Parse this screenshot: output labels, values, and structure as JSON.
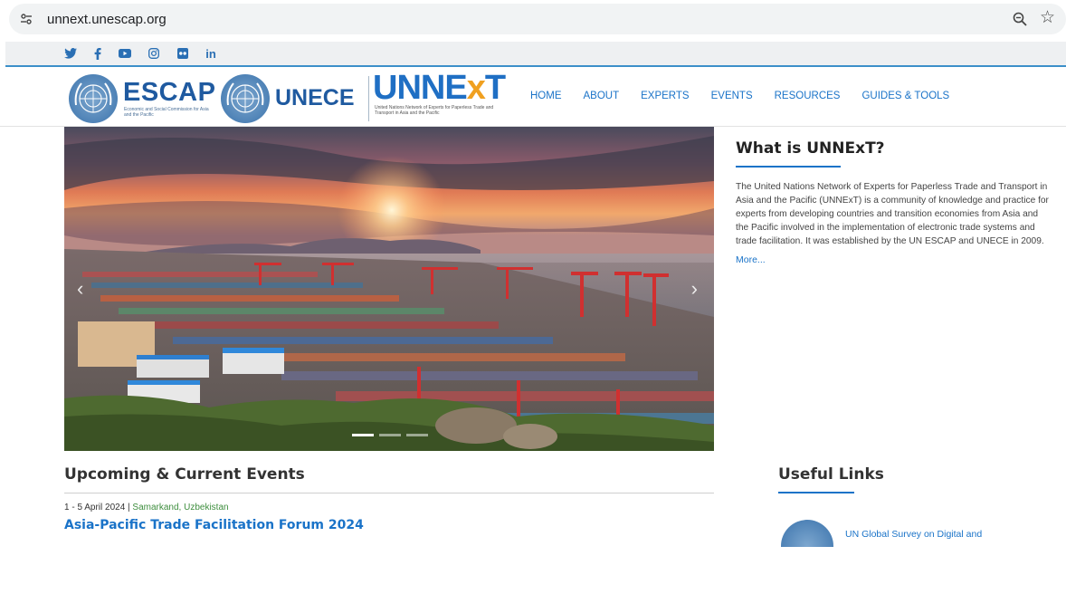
{
  "browser": {
    "url": "unnext.unescap.org"
  },
  "social": {
    "items": [
      {
        "name": "twitter",
        "glyph": "🐦"
      },
      {
        "name": "facebook",
        "glyph": "f"
      },
      {
        "name": "youtube",
        "glyph": "▶"
      },
      {
        "name": "instagram",
        "glyph": "◎"
      },
      {
        "name": "flickr",
        "glyph": "●●"
      },
      {
        "name": "linkedin",
        "glyph": "in"
      }
    ]
  },
  "header": {
    "escap": "ESCAP",
    "escap_sub": "Economic and Social Commission for Asia and the Pacific",
    "unece": "UNECE",
    "unnext_main": "UNNE",
    "unnext_x": "x",
    "unnext_t": "T",
    "unnext_sub": "United Nations Network of Experts for Paperless Trade and Transport in Asia and the Pacific",
    "nav": [
      "HOME",
      "ABOUT",
      "EXPERTS",
      "EVENTS",
      "RESOURCES",
      "GUIDES & TOOLS"
    ]
  },
  "hero": {
    "prev": "‹",
    "next": "›",
    "slides": 3,
    "active_slide": 1
  },
  "about": {
    "title": "What is UNNExT?",
    "body": "The United Nations Network of Experts for Paperless Trade and Transport in Asia and the Pacific (UNNExT) is a community of knowledge and practice for experts from developing countries and transition economies from Asia and the Pacific involved in the implementation of electronic trade systems and trade facilitation. It was established by the UN ESCAP and UNECE in 2009.",
    "more": "More..."
  },
  "events": {
    "title": "Upcoming & Current Events",
    "date": "1 - 5 April 2024",
    "separator": " | ",
    "location": "Samarkand, Uzbekistan",
    "event_title": "Asia-Pacific Trade Facilitation Forum 2024"
  },
  "links": {
    "title": "Useful Links",
    "first": "UN Global Survey on Digital and"
  },
  "colors": {
    "accent": "#1a73c8",
    "green": "#3e8e3e",
    "brand_blue": "#1f5aa0",
    "orange": "#f0a020"
  }
}
